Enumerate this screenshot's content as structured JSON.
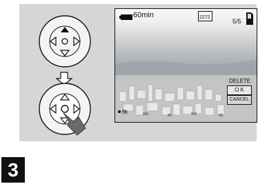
{
  "lcd": {
    "battery_time": "60min",
    "image_size": "2272",
    "frame_count": "5/5",
    "delete_menu": {
      "title": "DELETE",
      "ok": "O K",
      "cancel": "CANCEL"
    },
    "hint": "OK"
  },
  "step": {
    "number": "3"
  },
  "icons": {
    "battery": "battery-icon",
    "memory_card": "memory-card-icon",
    "up_arrow": "up-arrow-icon",
    "down_arrow": "down-arrow-icon",
    "left_arrow": "left-arrow-icon",
    "right_arrow": "right-arrow-icon",
    "center_button": "center-button-icon",
    "step_down_arrow": "step-down-arrow-icon",
    "pointing_hand": "pointing-hand-icon"
  },
  "colors": {
    "panel": "#d6d6d6",
    "step_box": "#111111"
  }
}
